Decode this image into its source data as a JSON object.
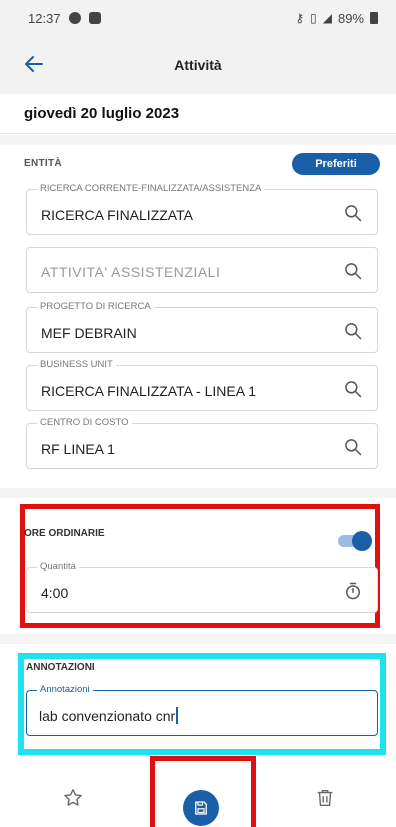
{
  "status_bar": {
    "time": "12:37",
    "battery": "89%"
  },
  "app_bar": {
    "title": "Attività"
  },
  "date": "giovedì 20 luglio 2023",
  "entita": {
    "section_label": "ENTITÀ",
    "favorites_button": "Preferiti",
    "fields": [
      {
        "label": "RICERCA CORRENTE-FINALIZZATA/ASSISTENZA",
        "value": "RICERCA FINALIZZATA"
      },
      {
        "placeholder": "ATTIVITA' ASSISTENZIALI"
      },
      {
        "label": "PROGETTO DI RICERCA",
        "value": "MEF DEBRAIN"
      },
      {
        "label": "BUSINESS UNIT",
        "value": "RICERCA FINALIZZATA - LINEA 1"
      },
      {
        "label": "CENTRO DI COSTO",
        "value": "RF LINEA 1"
      }
    ]
  },
  "ore_ordinarie": {
    "section_label": "ORE ORDINARIE",
    "toggle_on": true,
    "quantity_label": "Quantità",
    "quantity_value": "4:00"
  },
  "annotazioni": {
    "section_label": "ANNOTAZIONI",
    "field_label": "Annotazioni",
    "field_value": "lab convenzionato cnr"
  },
  "bottom_bar": {
    "icons": [
      "star-icon",
      "save-icon",
      "trash-icon"
    ]
  },
  "colors": {
    "accent": "#1a5fa8",
    "highlight_red": "#e01010",
    "highlight_cyan": "#1ee2ee"
  }
}
